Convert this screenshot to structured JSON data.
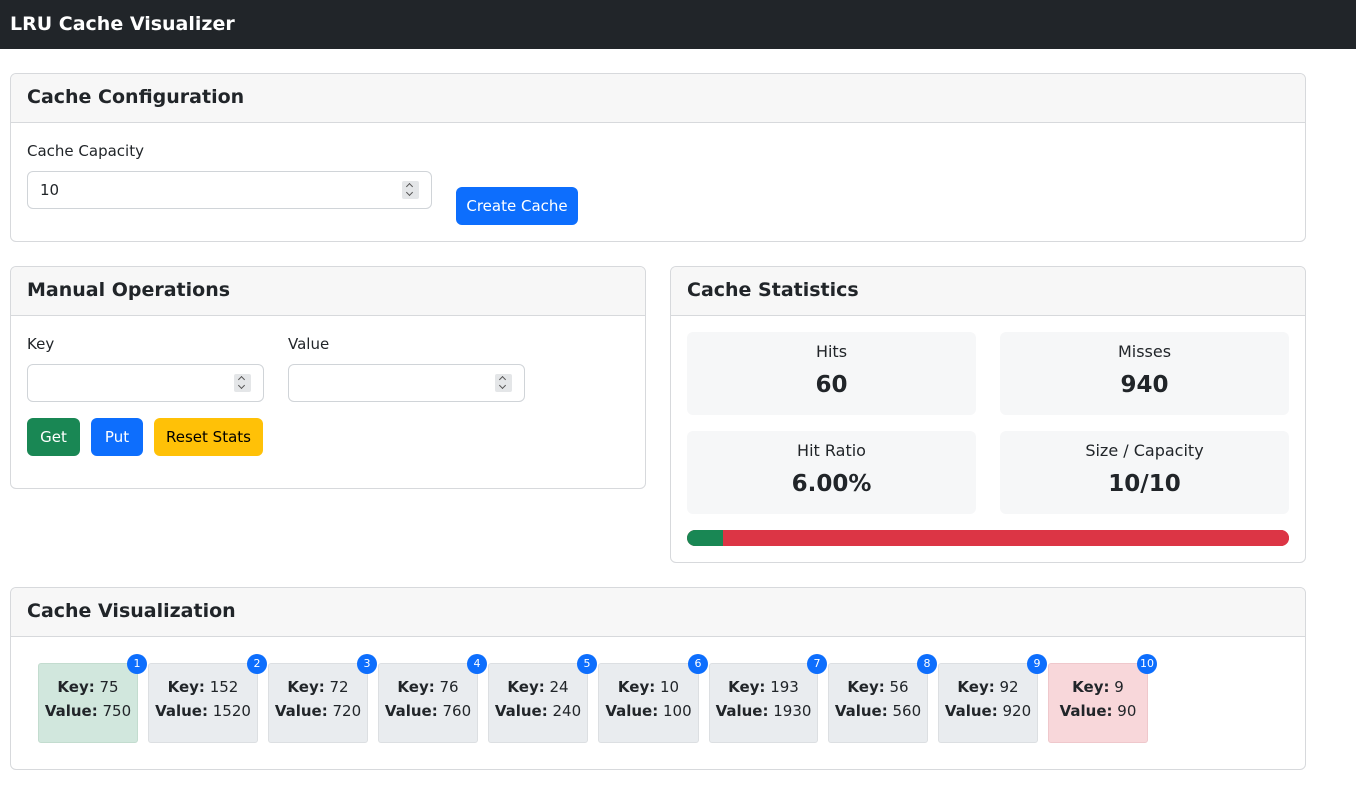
{
  "app": {
    "title": "LRU Cache Visualizer"
  },
  "config": {
    "header": "Cache Configuration",
    "capacity_label": "Cache Capacity",
    "capacity_value": "10",
    "create_button": "Create Cache"
  },
  "manual": {
    "header": "Manual Operations",
    "key_label": "Key",
    "key_value": "",
    "value_label": "Value",
    "value_value": "",
    "get_button": "Get",
    "put_button": "Put",
    "reset_button": "Reset Stats"
  },
  "stats": {
    "header": "Cache Statistics",
    "hits_label": "Hits",
    "hits_value": "60",
    "misses_label": "Misses",
    "misses_value": "940",
    "ratio_label": "Hit Ratio",
    "ratio_value": "6.00%",
    "size_label": "Size / Capacity",
    "size_value": "10/10",
    "hit_fraction": 0.06,
    "miss_fraction": 0.94
  },
  "visualization": {
    "header": "Cache Visualization",
    "key_label": "Key:",
    "value_label": "Value:",
    "nodes": [
      {
        "badge": "1",
        "key": "75",
        "value": "750",
        "state": "mru"
      },
      {
        "badge": "2",
        "key": "152",
        "value": "1520",
        "state": "normal"
      },
      {
        "badge": "3",
        "key": "72",
        "value": "720",
        "state": "normal"
      },
      {
        "badge": "4",
        "key": "76",
        "value": "760",
        "state": "normal"
      },
      {
        "badge": "5",
        "key": "24",
        "value": "240",
        "state": "normal"
      },
      {
        "badge": "6",
        "key": "10",
        "value": "100",
        "state": "normal"
      },
      {
        "badge": "7",
        "key": "193",
        "value": "1930",
        "state": "normal"
      },
      {
        "badge": "8",
        "key": "56",
        "value": "560",
        "state": "normal"
      },
      {
        "badge": "9",
        "key": "92",
        "value": "920",
        "state": "normal"
      },
      {
        "badge": "10",
        "key": "9",
        "value": "90",
        "state": "lru"
      }
    ]
  },
  "colors": {
    "navbar": "#212529",
    "primary": "#0d6efd",
    "success": "#198754",
    "warning": "#ffc107",
    "danger": "#dc3545",
    "mru_node": "#d1e7dd",
    "lru_node": "#f8d7da"
  }
}
